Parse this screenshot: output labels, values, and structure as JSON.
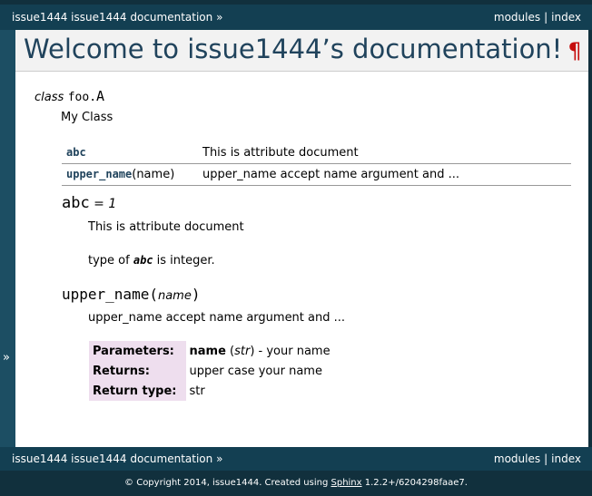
{
  "relbar": {
    "breadcrumb": "issue1444 issue1444 documentation",
    "breadcrumb_arrow": "»",
    "modules": "modules",
    "index": "index",
    "separator": "|"
  },
  "sidebar": {
    "toggle": "»"
  },
  "page": {
    "title": "Welcome to issue1444’s documentation!",
    "pilcrow": "¶"
  },
  "class_entry": {
    "keyword": "class",
    "module": "foo.",
    "name": "A",
    "description": "My Class"
  },
  "summary_table": [
    {
      "name": "abc",
      "args": "",
      "description": "This is attribute document"
    },
    {
      "name": "upper_name",
      "args": "(name)",
      "description": "upper_name accept name argument and ..."
    }
  ],
  "attribute": {
    "name": "abc",
    "value": " = 1",
    "description": "This is attribute document",
    "type_prefix": "type of ",
    "type_name": "abc",
    "type_suffix": " is integer."
  },
  "method": {
    "name": "upper_name",
    "open_paren": "(",
    "arg": "name",
    "close_paren": ")",
    "description": "upper_name accept name argument and ...",
    "fields": {
      "parameters_label": "Parameters:",
      "param_name": "name",
      "param_type_open": " (",
      "param_type": "str",
      "param_type_close": ")",
      "param_desc": " - your name",
      "returns_label": "Returns:",
      "returns_value": "upper case your name",
      "return_type_label": "Return type:",
      "return_type_value": "str"
    }
  },
  "footer": {
    "prefix": "© Copyright 2014, issue1444. Created using ",
    "link": "Sphinx",
    "suffix": " 1.2.2+/6204298faae7."
  }
}
